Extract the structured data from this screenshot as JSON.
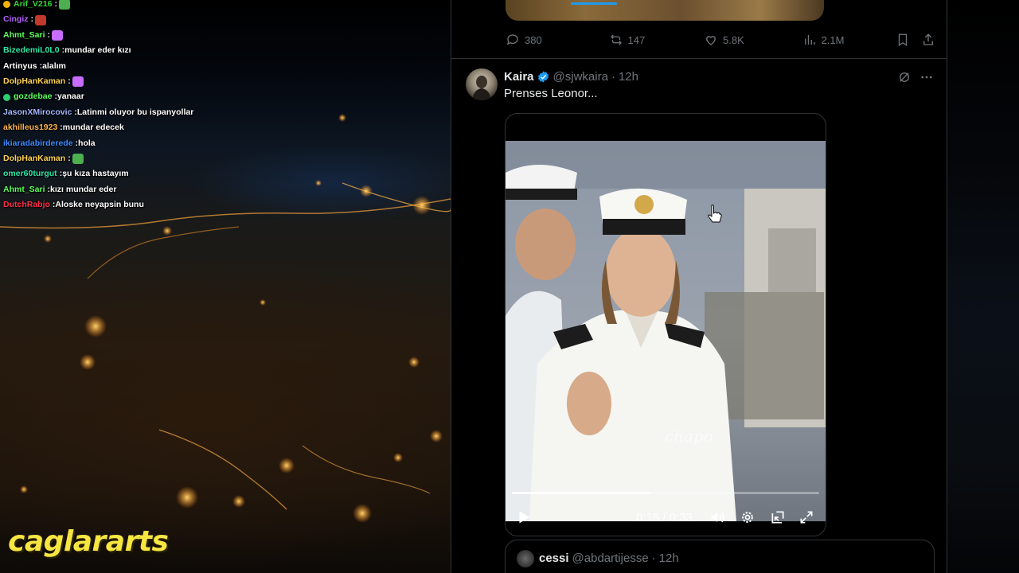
{
  "colors": {
    "accent": "#1d9bf0",
    "text_primary": "#e7e9ea",
    "text_secondary": "#71767b",
    "watermark": "#f7e642"
  },
  "chat": {
    "messages": [
      {
        "user": "Arif_V216",
        "text": "",
        "color": "#33d633",
        "badge": "#f0b400",
        "emote": "pepe"
      },
      {
        "user": "Cingiz",
        "text": "",
        "color": "#b45cff",
        "emote": "kekw"
      },
      {
        "user": "Ahmt_Sari",
        "text": "",
        "color": "#5cff5c",
        "emote": "heart"
      },
      {
        "user": "BizedemiL0L0",
        "text": "mundar eder kızı",
        "color": "#2ee6a8"
      },
      {
        "user": "Artinyus",
        "text": "alalım",
        "color": "#ffffff"
      },
      {
        "user": "DolpHanKaman",
        "text": "",
        "color": "#ffd24d",
        "emote": "heart"
      },
      {
        "user": "gozdebae",
        "text": "yanaar",
        "color": "#5cff5c",
        "badge": "#2ecc71"
      },
      {
        "user": "JasonXMirocovic",
        "text": "Latinmi oluyor bu ispanyollar",
        "color": "#a4b8ff"
      },
      {
        "user": "akhilleus1923",
        "text": "mundar edecek",
        "color": "#ffb347"
      },
      {
        "user": "ikiaradabirderede",
        "text": "hola",
        "color": "#3d8bff"
      },
      {
        "user": "DolpHanKaman",
        "text": "",
        "color": "#ffd24d",
        "emote": "pepe"
      },
      {
        "user": "omer60turgut",
        "text": "şu kıza hastayım",
        "color": "#2ee6a8"
      },
      {
        "user": "Ahmt_Sari",
        "text": "kızı mundar eder",
        "color": "#5cff5c"
      },
      {
        "user": "DutchRabjo",
        "text": "Aloske neyapsin bunu",
        "color": "#ff2e4a"
      }
    ]
  },
  "watermark": "caglararts",
  "previous_tweet": {
    "replies": "380",
    "reposts": "147",
    "likes": "5.8K",
    "views": "2.1M",
    "icons": [
      "reply-icon",
      "repost-icon",
      "like-icon",
      "views-icon",
      "bookmark-icon",
      "share-icon"
    ]
  },
  "tweet": {
    "author": "Kaira",
    "handle": "@sjwkaira",
    "separator": "·",
    "time": "12h",
    "text": "Prenses Leonor...",
    "video": {
      "progress": 0.45,
      "time_label": "0:15 / 0:33",
      "watermark_text": "chapo",
      "controls": [
        "play-icon",
        "volume-icon",
        "settings-icon",
        "picture-in-picture-icon",
        "fullscreen-icon"
      ]
    }
  },
  "reply": {
    "name": "cessi",
    "handle": "@abdartijesse",
    "separator": "·",
    "time": "12h"
  }
}
